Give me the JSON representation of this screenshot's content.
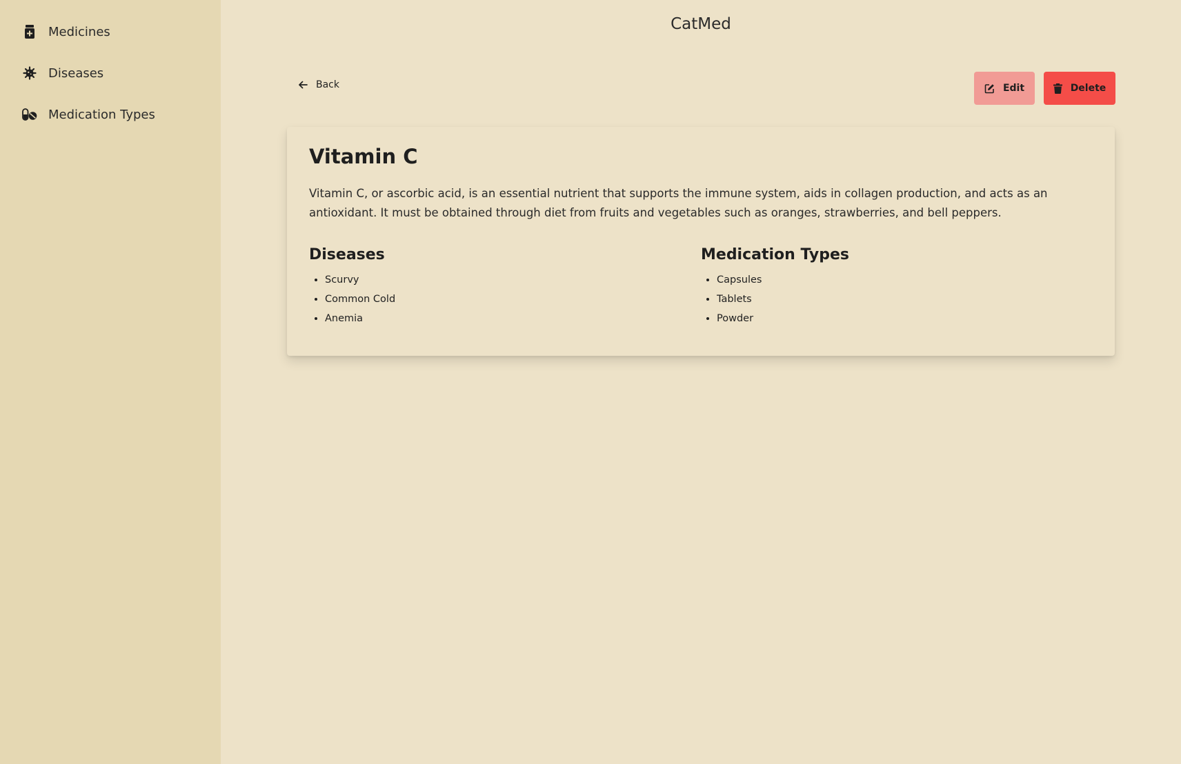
{
  "app": {
    "title": "CatMed"
  },
  "sidebar": {
    "items": [
      {
        "label": "Medicines",
        "icon": "medicine-bottle-icon"
      },
      {
        "label": "Diseases",
        "icon": "virus-icon"
      },
      {
        "label": "Medication Types",
        "icon": "pills-icon"
      }
    ]
  },
  "toolbar": {
    "back_label": "Back",
    "edit_label": "Edit",
    "delete_label": "Delete"
  },
  "medicine": {
    "name": "Vitamin C",
    "description": "Vitamin C, or ascorbic acid, is an essential nutrient that supports the immune system, aids in collagen production, and acts as an antioxidant. It must be obtained through diet from fruits and vegetables such as oranges, strawberries, and bell peppers.",
    "diseases_heading": "Diseases",
    "diseases": [
      "Scurvy",
      "Common Cold",
      "Anemia"
    ],
    "types_heading": "Medication Types",
    "medication_types": [
      "Capsules",
      "Tablets",
      "Powder"
    ]
  },
  "colors": {
    "sidebar_bg": "#e5d8b3",
    "main_bg": "#ede2c8",
    "edit_button": "#f19b95",
    "delete_button": "#f44d48"
  }
}
